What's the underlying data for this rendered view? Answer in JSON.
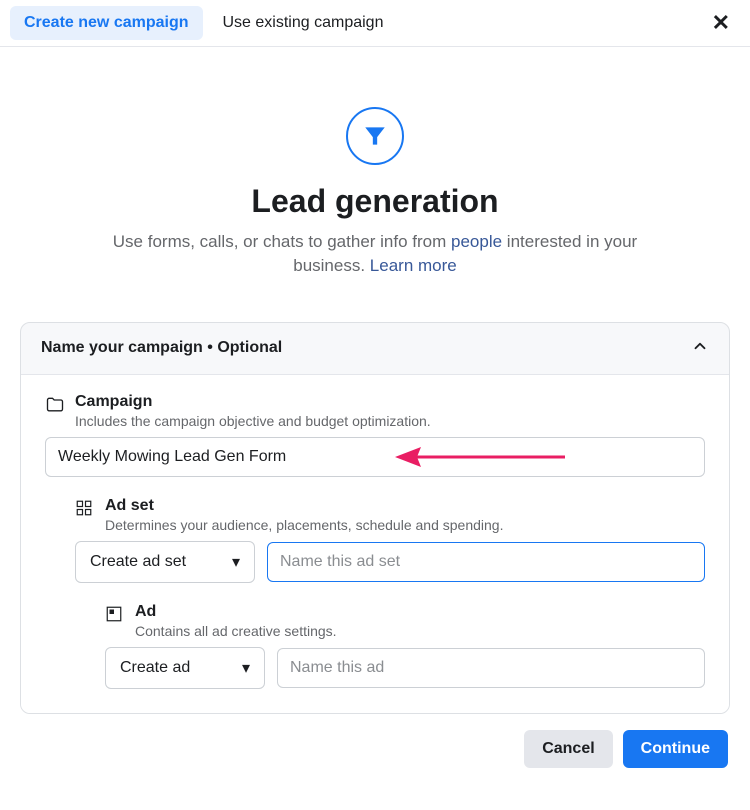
{
  "header": {
    "tab_active": "Create new campaign",
    "tab_inactive": "Use existing campaign"
  },
  "hero": {
    "title": "Lead generation",
    "desc_before": "Use forms, calls, or chats to gather info from ",
    "people": "people",
    "desc_after": " interested in your business. ",
    "learn_more": "Learn more"
  },
  "panel": {
    "title": "Name your campaign • Optional"
  },
  "campaign": {
    "label": "Campaign",
    "desc": "Includes the campaign objective and budget optimization.",
    "value": "Weekly Mowing Lead Gen Form"
  },
  "adset": {
    "label": "Ad set",
    "desc": "Determines your audience, placements, schedule and spending.",
    "dropdown": "Create ad set",
    "placeholder": "Name this ad set"
  },
  "ad": {
    "label": "Ad",
    "desc": "Contains all ad creative settings.",
    "dropdown": "Create ad",
    "placeholder": "Name this ad"
  },
  "footer": {
    "cancel": "Cancel",
    "continue": "Continue"
  }
}
